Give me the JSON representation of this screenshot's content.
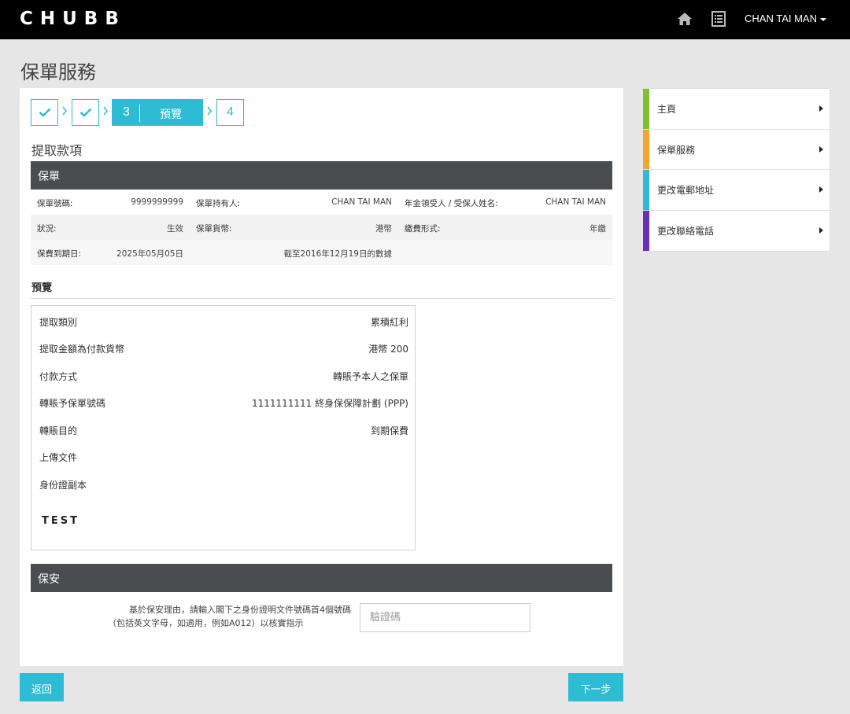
{
  "header": {
    "logo": "CHUBB",
    "user_name": "CHAN TAI MAN"
  },
  "page_title": "保單服務",
  "steps": {
    "current_number": "3",
    "current_label": "預覽",
    "next_number": "4"
  },
  "section_heading": "提取款項",
  "policy": {
    "bar_title": "保單",
    "rows": [
      [
        {
          "label": "保單號碼:",
          "value": "9999999999"
        },
        {
          "label": "保單持有人:",
          "value": "CHAN TAI MAN"
        },
        {
          "label": "年金領受人 / 受保人姓名:",
          "value": "CHAN TAI MAN"
        }
      ],
      [
        {
          "label": "狀況:",
          "value": "生效"
        },
        {
          "label": "保單貨幣:",
          "value": "港幣"
        },
        {
          "label": "繳費形式:",
          "value": "年繳"
        }
      ],
      [
        {
          "label": "保費到期日:",
          "value": "2025年05月05日"
        },
        {
          "label": "",
          "value": "截至2016年12月19日的數據"
        }
      ]
    ]
  },
  "preview": {
    "title": "預覽",
    "rows": [
      {
        "label": "提取類別",
        "value": "累積紅利"
      },
      {
        "label": "提取金額為付款貨幣",
        "value": "港幣 200"
      },
      {
        "label": "付款方式",
        "value": "轉賬予本人之保單"
      },
      {
        "label": "轉賬予保單號碼",
        "value": "1111111111 終身保保障計劃 (PPP)"
      },
      {
        "label": "轉賬目的",
        "value": "到期保費"
      },
      {
        "label": "上傳文件",
        "value": ""
      },
      {
        "label": "身份證副本",
        "value": ""
      }
    ],
    "attachment_text": "TEST"
  },
  "security": {
    "bar_title": "保安",
    "instruction_line1": "基於保安理由，請輸入閣下之身份證明文件號碼首4個號碼",
    "instruction_line2": "（包括英文字母，如適用，例如A012）以核實指示",
    "input_placeholder": "驗證碼",
    "input_value": ""
  },
  "buttons": {
    "back": "返回",
    "next": "下一步"
  },
  "sidebar": {
    "items": [
      {
        "label": "主頁",
        "color": "#7ec12f"
      },
      {
        "label": "保單服務",
        "color": "#f4a52b"
      },
      {
        "label": "更改電郵地址",
        "color": "#2ebcd4"
      },
      {
        "label": "更改聯絡電話",
        "color": "#6c2fb8"
      }
    ]
  },
  "colors": {
    "accent": "#2ebcd4",
    "header_bg": "#000000",
    "dark_bar": "#4a4d50"
  }
}
